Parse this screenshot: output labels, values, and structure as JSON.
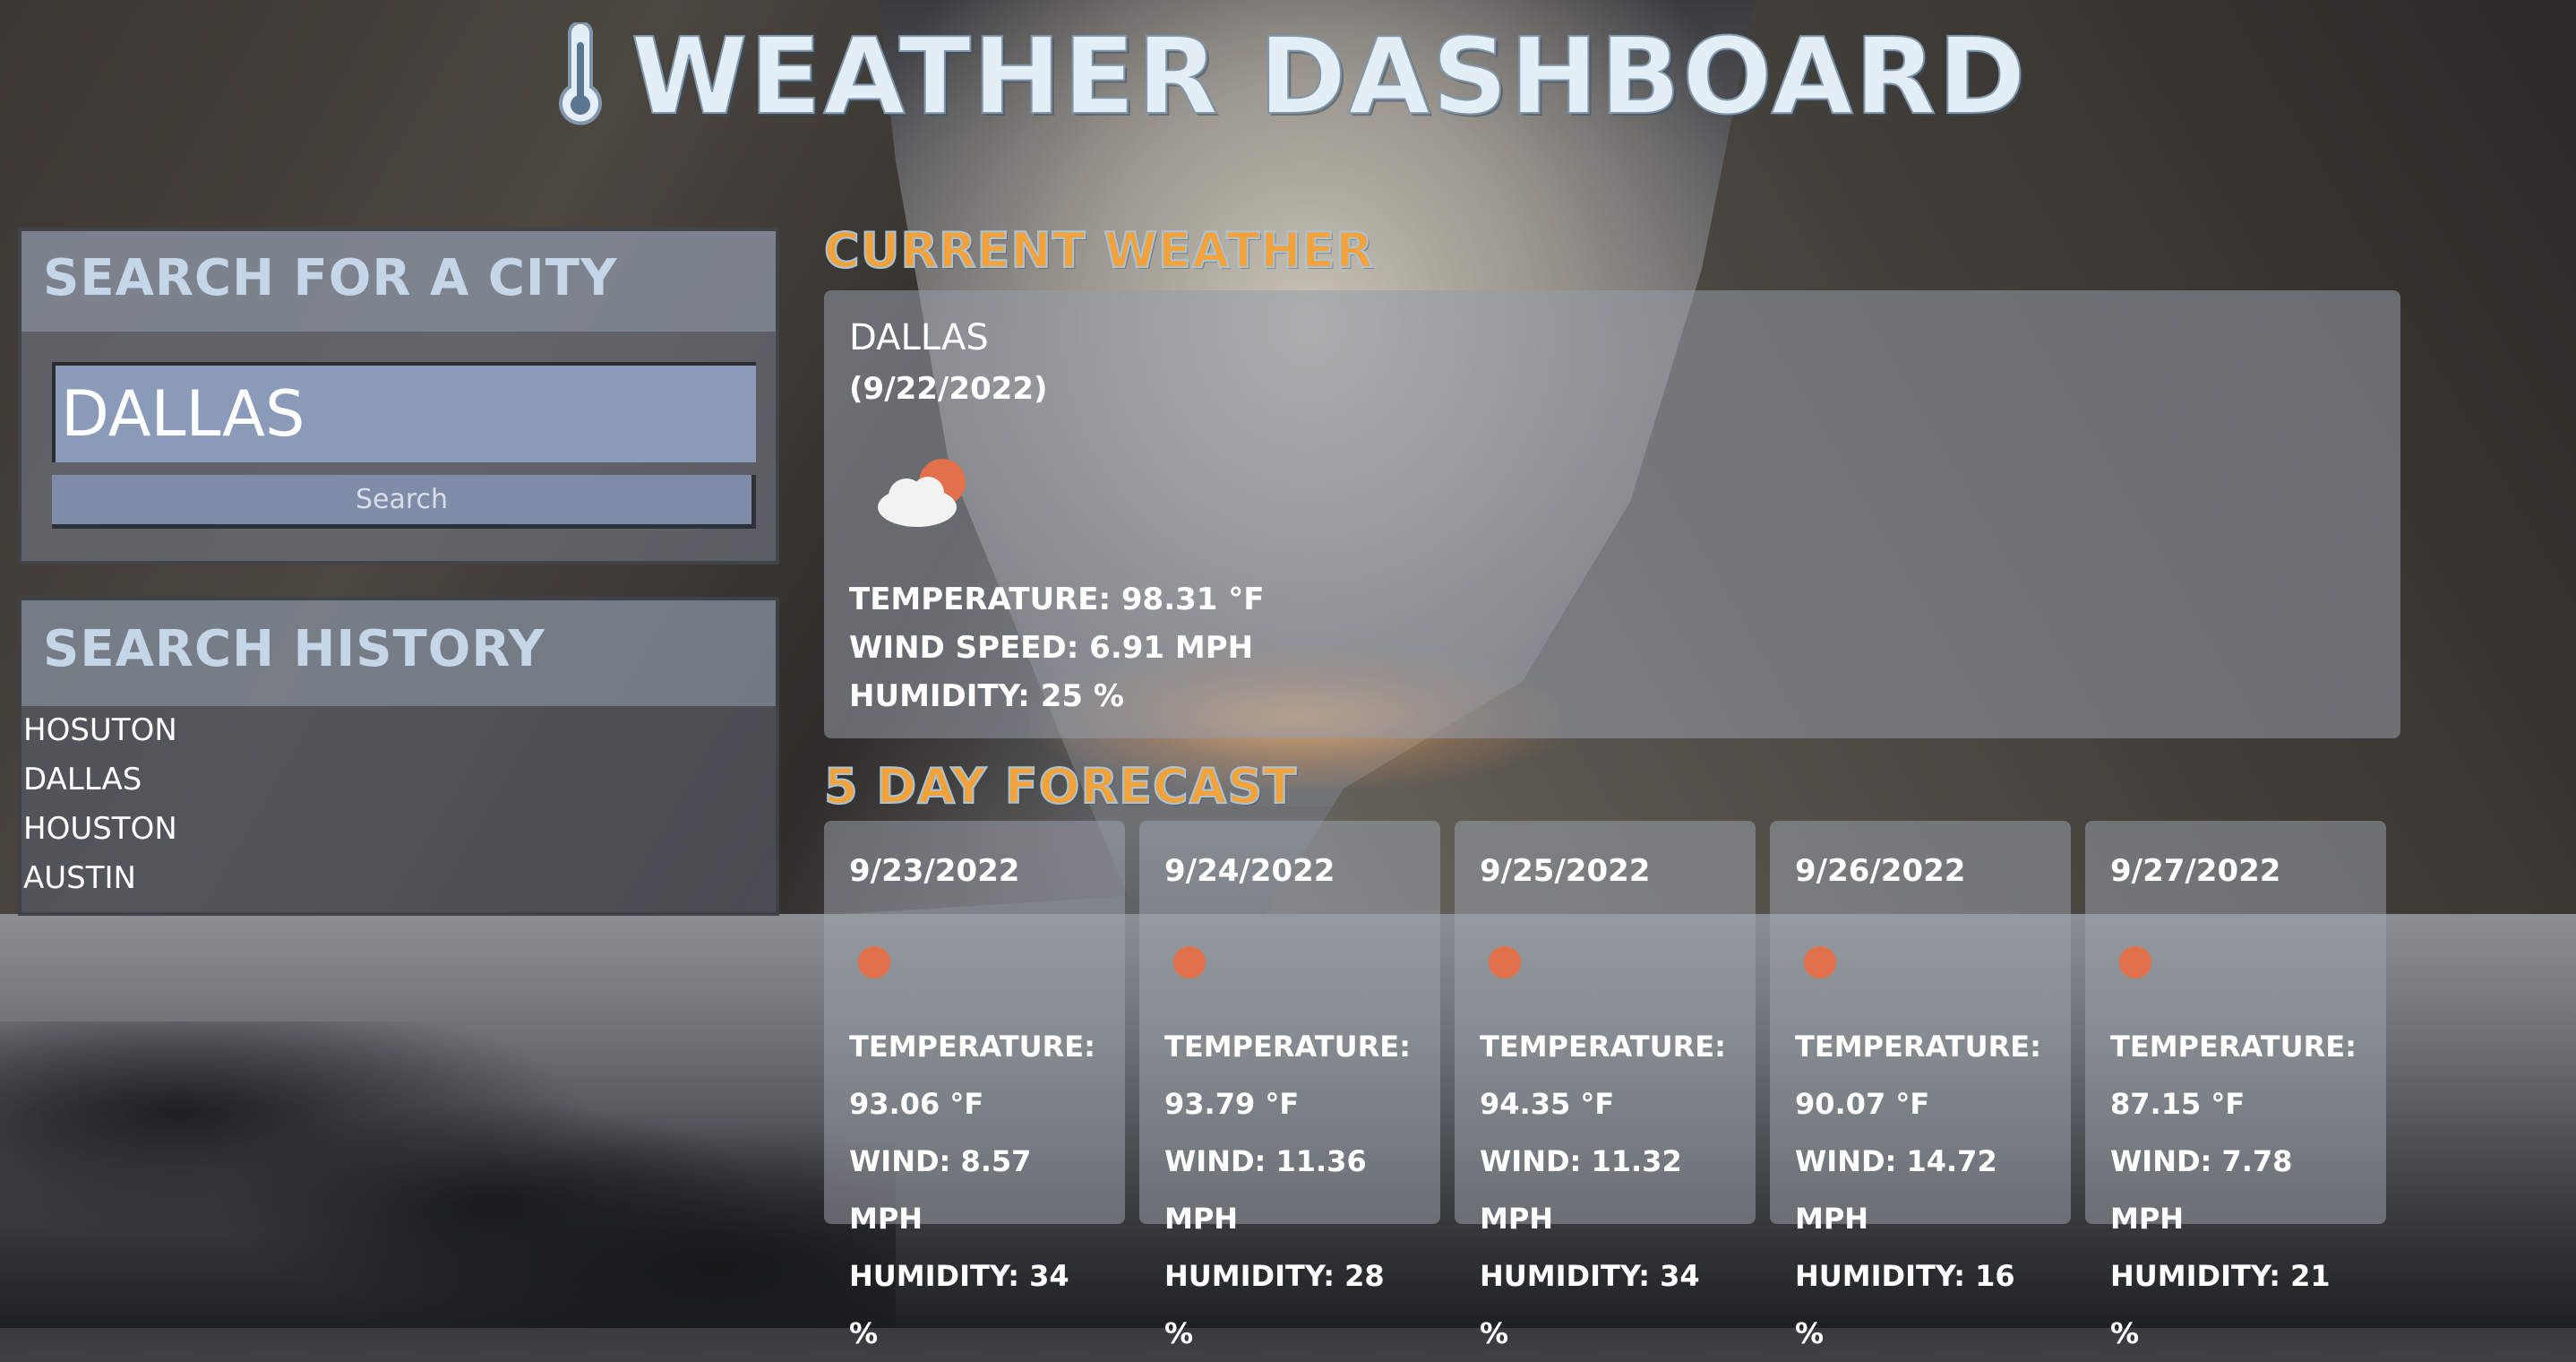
{
  "header": {
    "title": "WEATHER DASHBOARD",
    "icon": "thermometer-icon"
  },
  "search": {
    "heading": "SEARCH FOR A CITY",
    "input_value": "DALLAS",
    "button_label": "Search"
  },
  "history": {
    "heading": "SEARCH HISTORY",
    "items": [
      "HOSUTON",
      "DALLAS",
      "HOUSTON",
      "AUSTIN"
    ]
  },
  "current": {
    "section_title": "CURRENT WEATHER",
    "city": "DALLAS",
    "date": "(9/22/2022)",
    "icon": "partly-cloudy-icon",
    "temperature": "TEMPERATURE: 98.31 °F",
    "wind": "WIND SPEED: 6.91 MPH",
    "humidity": "HUMIDITY: 25 %"
  },
  "forecast": {
    "section_title": "5 DAY FORECAST",
    "days": [
      {
        "date": "9/23/2022",
        "icon": "sun-icon",
        "temp_label": "TEMPERATURE:",
        "temp_value": "93.06 °F",
        "wind_label": "WIND: 8.57",
        "wind_unit": "MPH",
        "humidity_label": "HUMIDITY: 34",
        "humidity_unit": "%"
      },
      {
        "date": "9/24/2022",
        "icon": "sun-icon",
        "temp_label": "TEMPERATURE:",
        "temp_value": "93.79 °F",
        "wind_label": "WIND: 11.36",
        "wind_unit": "MPH",
        "humidity_label": "HUMIDITY: 28",
        "humidity_unit": "%"
      },
      {
        "date": "9/25/2022",
        "icon": "sun-icon",
        "temp_label": "TEMPERATURE:",
        "temp_value": "94.35 °F",
        "wind_label": "WIND: 11.32",
        "wind_unit": "MPH",
        "humidity_label": "HUMIDITY: 34",
        "humidity_unit": "%"
      },
      {
        "date": "9/26/2022",
        "icon": "sun-icon",
        "temp_label": "TEMPERATURE:",
        "temp_value": "90.07 °F",
        "wind_label": "WIND: 14.72",
        "wind_unit": "MPH",
        "humidity_label": "HUMIDITY: 16",
        "humidity_unit": "%"
      },
      {
        "date": "9/27/2022",
        "icon": "sun-icon",
        "temp_label": "TEMPERATURE:",
        "temp_value": "87.15 °F",
        "wind_label": "WIND: 7.78",
        "wind_unit": "MPH",
        "humidity_label": "HUMIDITY: 21",
        "humidity_unit": "%"
      }
    ]
  },
  "colors": {
    "section_title": "#f2a23a",
    "panel_heading": "#c5d6e8",
    "sun": "#e2704a",
    "input_bg": "#8a9bb9"
  }
}
